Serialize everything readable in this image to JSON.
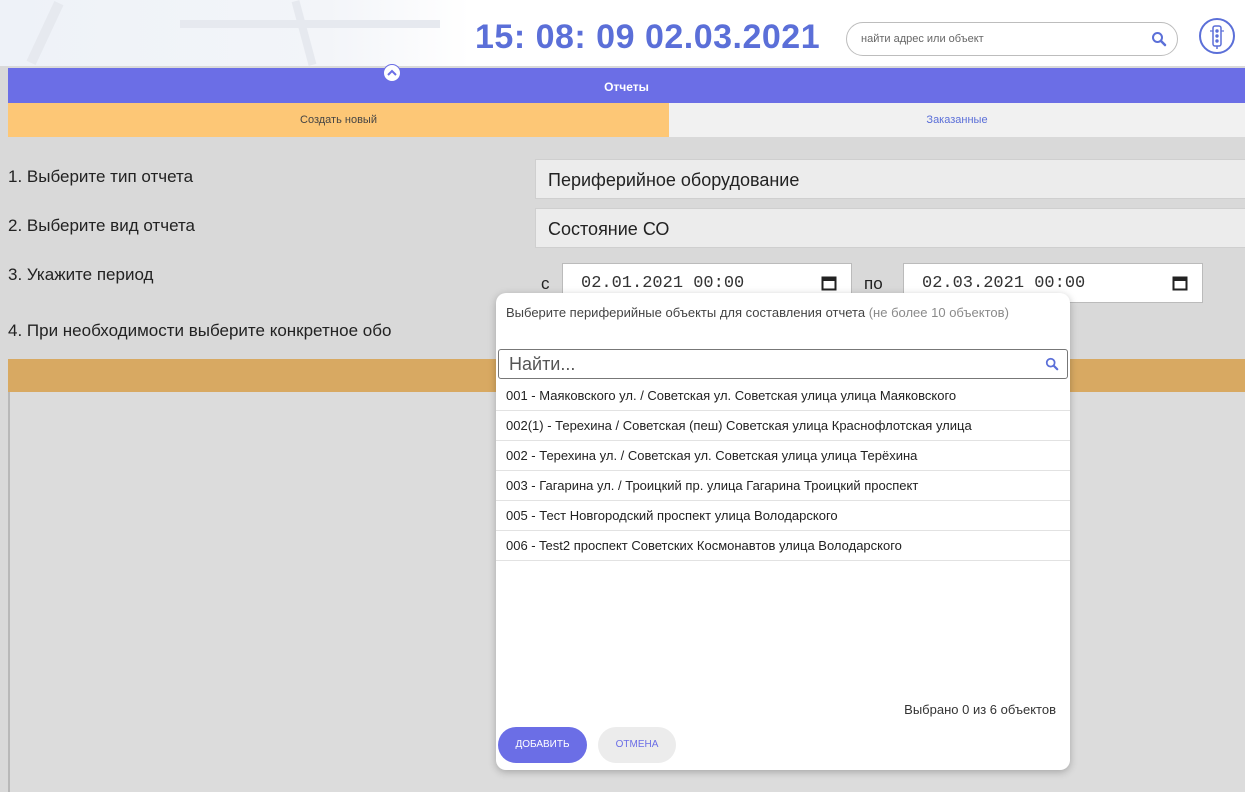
{
  "header": {
    "clock": "15: 08: 09  02.03.2021",
    "search_placeholder": "найти адрес или объект",
    "search_icon": "search-icon",
    "traffic_icon": "traffic-light-icon",
    "accent_color": "#5b6fd8"
  },
  "reports": {
    "title": "Отчеты",
    "tabs": [
      {
        "label": "Создать новый",
        "active": true
      },
      {
        "label": "Заказанные",
        "active": false
      }
    ]
  },
  "form": {
    "step1_label": "1. Выберите тип отчета",
    "step1_value": "Периферийное оборудование",
    "step2_label": "2. Выберите вид отчета",
    "step2_value": "Состояние СО",
    "step3_label": "3. Укажите период",
    "from_prefix": "с",
    "from_value": "02.01.2021 00:00",
    "to_prefix": "по",
    "to_value": "02.03.2021 00:00",
    "step4_label": "4. При необходимости выберите конкретное обо"
  },
  "dialog": {
    "heading": "Выберите периферийные объекты для составления отчета",
    "hint": "(не более 10 объектов)",
    "search_placeholder": "Найти...",
    "items": [
      "001 - Маяковского ул. / Советская ул. Советская улица улица Маяковского",
      "002(1) - Терехина / Советская (пеш) Советская улица Краснофлотская улица",
      "002 - Терехина ул. / Советская ул. Советская улица улица Терёхина",
      "003 - Гагарина ул. / Троицкий пр. улица Гагарина Троицкий проспект",
      "005 - Тест Новгородский проспект улица Володарского",
      "006 - Test2 проспект Советских Космонавтов улица Володарского"
    ],
    "selected_text": "Выбрано 0 из 6 объектов",
    "add_label": "ДОБАВИТЬ",
    "cancel_label": "ОТМЕНА"
  }
}
